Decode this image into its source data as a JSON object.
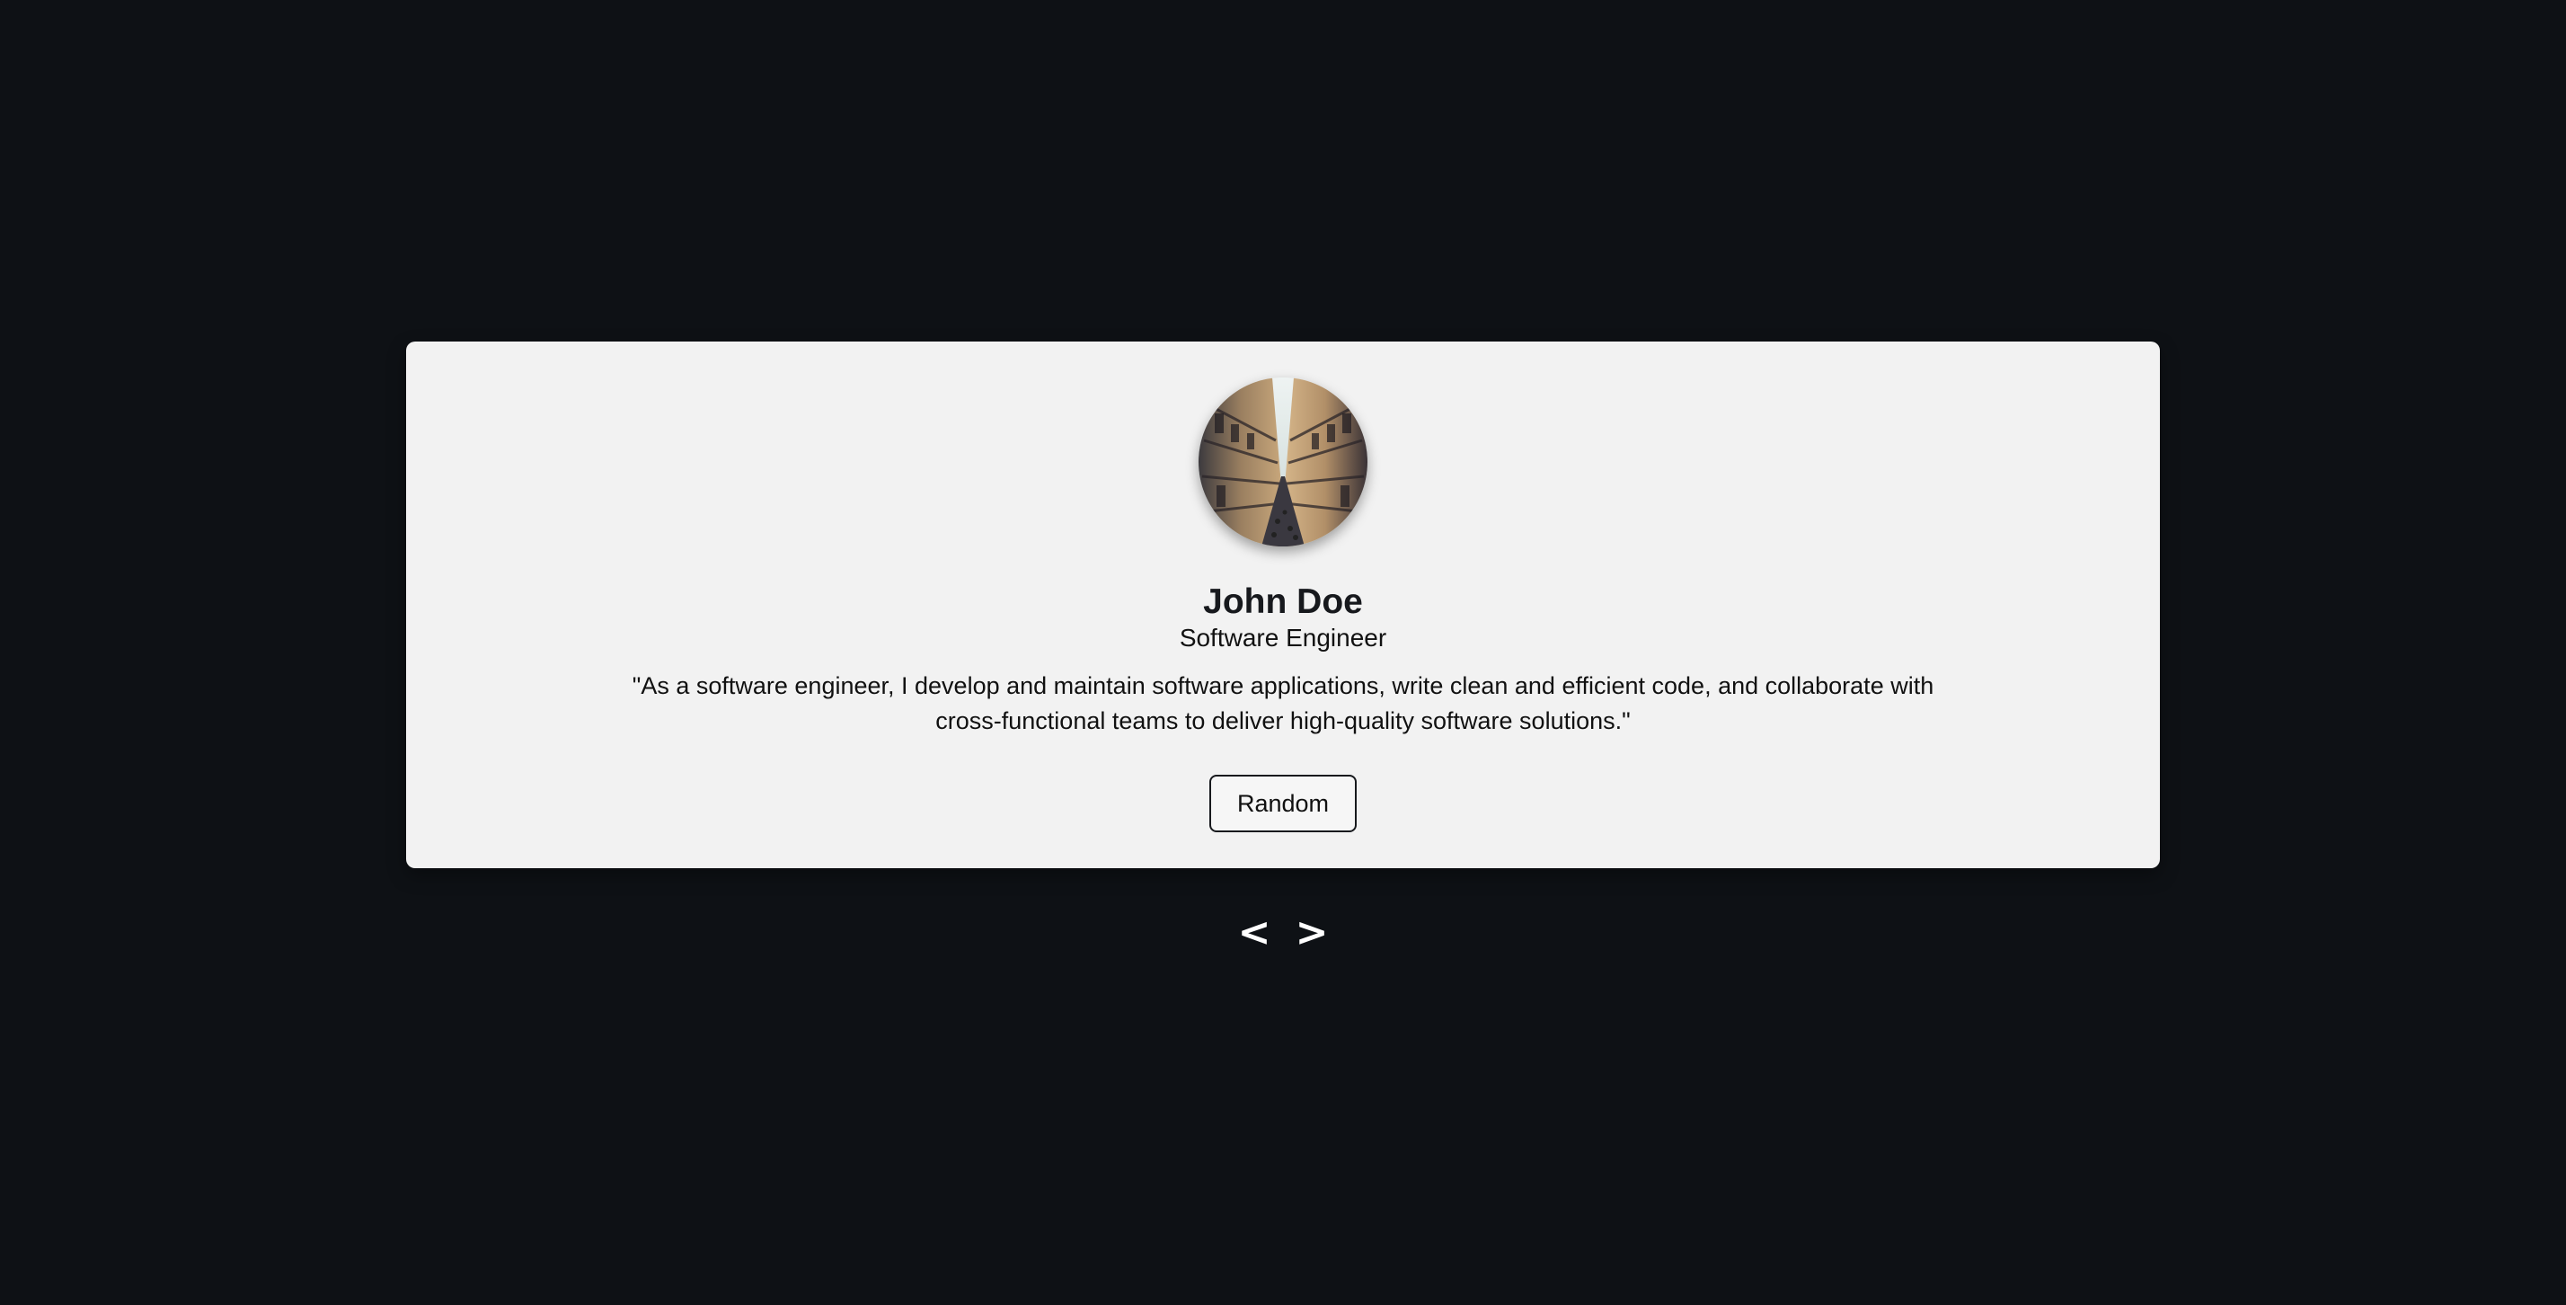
{
  "review": {
    "name": "John Doe",
    "job": "Software Engineer",
    "text": "\"As a software engineer, I develop and maintain software applications, write clean and efficient code, and collaborate with cross-functional teams to deliver high-quality software solutions.\"",
    "avatar_icon": "person-photo"
  },
  "controls": {
    "random_label": "Random",
    "prev_label": "<",
    "next_label": ">"
  },
  "colors": {
    "background": "#0e1115",
    "card": "#f2f2f2",
    "text": "#17191d",
    "nav_arrows": "#ffffff"
  }
}
